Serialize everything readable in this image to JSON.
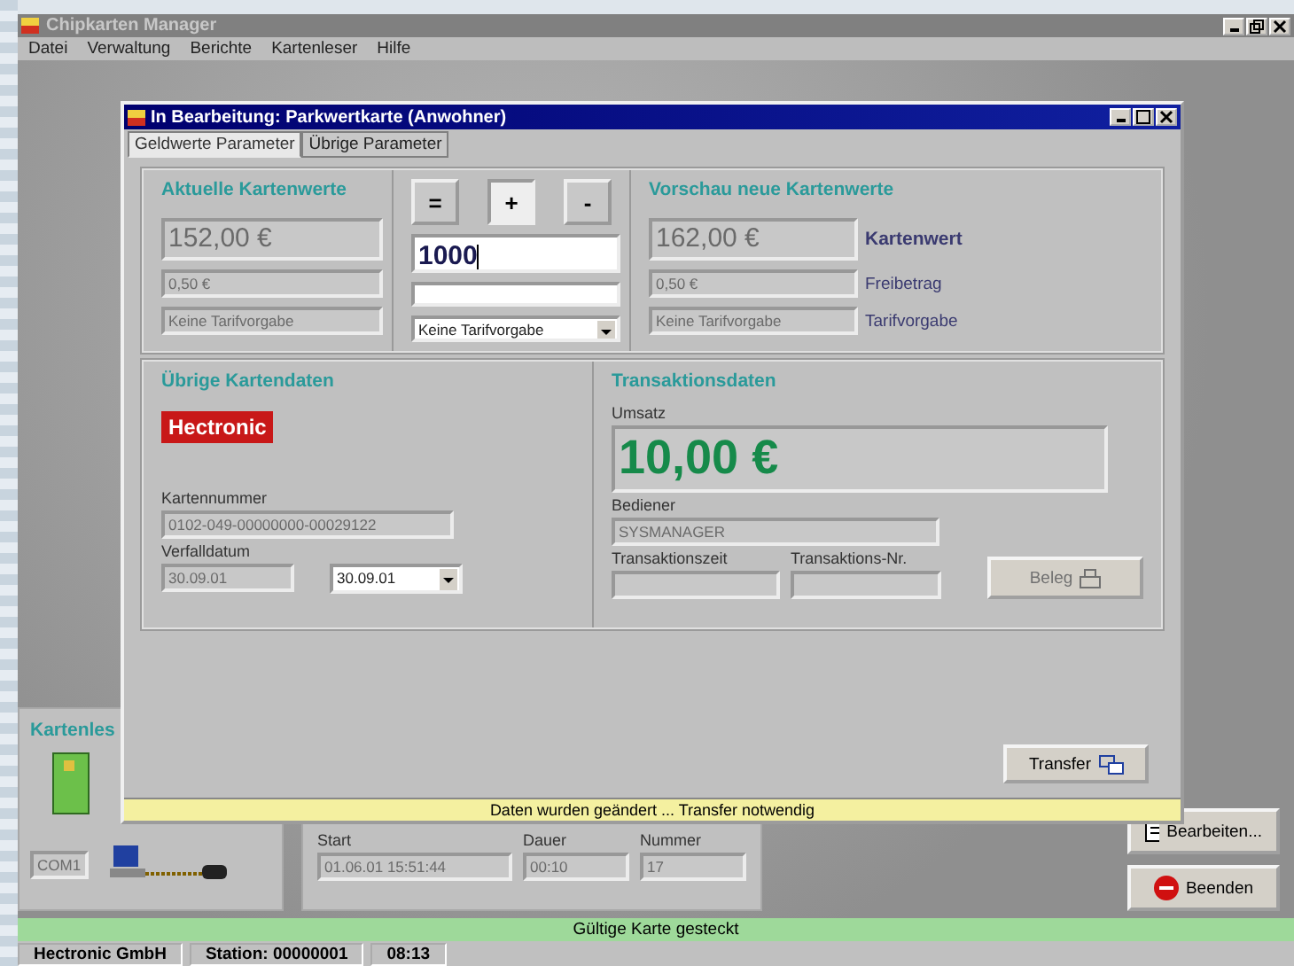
{
  "window": {
    "title": "Chipkarten Manager",
    "menu": [
      "Datei",
      "Verwaltung",
      "Berichte",
      "Kartenleser",
      "Hilfe"
    ]
  },
  "dialog": {
    "title": "In Bearbeitung: Parkwertkarte (Anwohner)",
    "tabs": [
      {
        "label": "Geldwerte Parameter",
        "selected": true
      },
      {
        "label": "Übrige Parameter",
        "selected": false
      }
    ],
    "current": {
      "heading": "Aktuelle Kartenwerte",
      "value": "152,00 €",
      "allowance": "0,50 €",
      "tariff": "Keine Tarifvorgabe"
    },
    "operators": [
      {
        "label": "=",
        "selected": false
      },
      {
        "label": "+",
        "selected": true
      },
      {
        "label": "-",
        "selected": false
      }
    ],
    "amount_input": {
      "value": "1000"
    },
    "tariff_select": {
      "value": "Keine Tarifvorgabe"
    },
    "preview": {
      "heading": "Vorschau neue Kartenwerte",
      "value": "162,00 €",
      "value_label": "Kartenwert",
      "allowance": "0,50 €",
      "allowance_label": "Freibetrag",
      "tariff": "Keine Tarifvorgabe",
      "tariff_label": "Tarifvorgabe"
    },
    "card_data": {
      "heading": "Übrige Kartendaten",
      "logo": "Hectronic",
      "card_number_label": "Kartennummer",
      "card_number": "0102-049-00000000-00029122",
      "expiry_label": "Verfalldatum",
      "expiry": "30.09.01",
      "expiry_select": "30.09.01"
    },
    "transaction": {
      "heading": "Transaktionsdaten",
      "turnover_label": "Umsatz",
      "turnover": "10,00 €",
      "operator_label": "Bediener",
      "operator": "SYSMANAGER",
      "time_label": "Transaktionszeit",
      "number_label": "Transaktions-Nr.",
      "receipt_button": {
        "label": "Beleg",
        "disabled": true
      }
    },
    "transfer_button": "Transfer",
    "notice": "Daten wurden geändert ... Transfer notwendig"
  },
  "reader": {
    "heading": "Kartenles",
    "port": "COM1"
  },
  "session": {
    "start_label": "Start",
    "start": "01.06.01 15:51:44",
    "duration_label": "Dauer",
    "duration": "00:10",
    "number_label": "Nummer",
    "number": "17"
  },
  "buttons": [
    "Bearbeiten...",
    "Beenden"
  ],
  "card_status": "Gültige Karte gesteckt",
  "status_bar": [
    "Hectronic GmbH",
    "Station: 00000001",
    "08:13"
  ]
}
